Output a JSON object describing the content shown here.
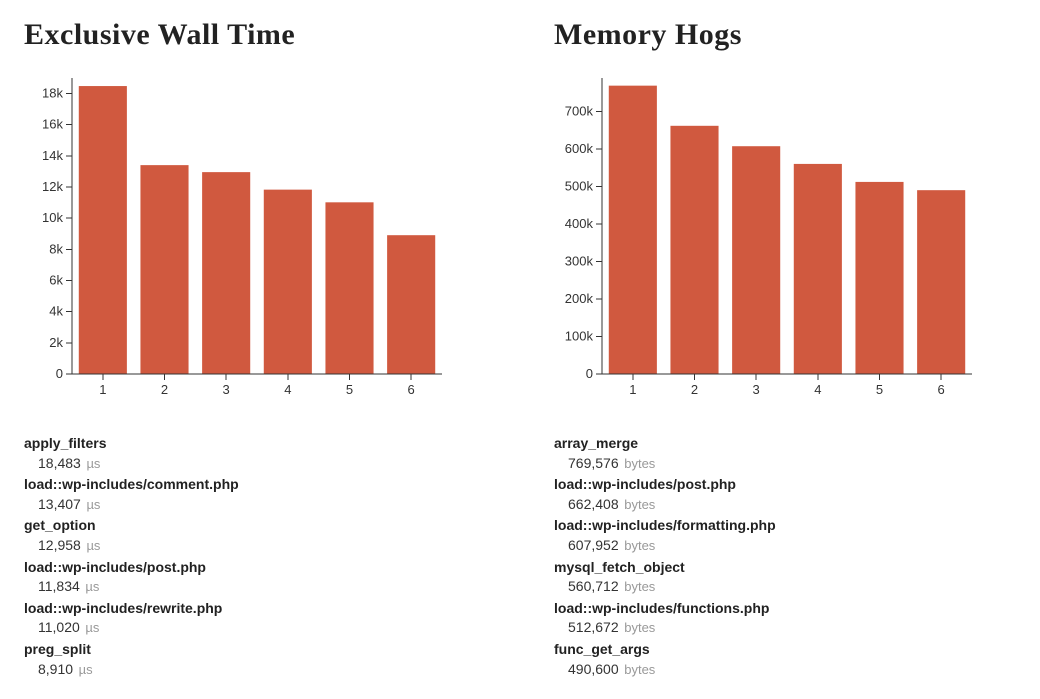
{
  "chart_data": [
    {
      "type": "bar",
      "title": "Exclusive Wall Time",
      "xlabel": "",
      "ylabel": "",
      "categories": [
        "1",
        "2",
        "3",
        "4",
        "5",
        "6"
      ],
      "x_tick_labels": [
        "1",
        "2",
        "3",
        "4",
        "5",
        "6"
      ],
      "values": [
        18483,
        13407,
        12958,
        11834,
        11020,
        8910
      ],
      "y_ticks": [
        0,
        2000,
        4000,
        6000,
        8000,
        10000,
        12000,
        14000,
        16000,
        18000
      ],
      "y_tick_labels": [
        "0",
        "2k",
        "4k",
        "6k",
        "8k",
        "10k",
        "12k",
        "14k",
        "16k",
        "18k"
      ],
      "ylim": [
        0,
        19000
      ],
      "grid": false,
      "unit": "µs",
      "items": [
        {
          "name": "apply_filters",
          "value": "18,483",
          "raw": 18483
        },
        {
          "name": "load::wp-includes/comment.php",
          "value": "13,407",
          "raw": 13407
        },
        {
          "name": "get_option",
          "value": "12,958",
          "raw": 12958
        },
        {
          "name": "load::wp-includes/post.php",
          "value": "11,834",
          "raw": 11834
        },
        {
          "name": "load::wp-includes/rewrite.php",
          "value": "11,020",
          "raw": 11020
        },
        {
          "name": "preg_split",
          "value": "8,910",
          "raw": 8910
        }
      ]
    },
    {
      "type": "bar",
      "title": "Memory Hogs",
      "xlabel": "",
      "ylabel": "",
      "categories": [
        "1",
        "2",
        "3",
        "4",
        "5",
        "6"
      ],
      "x_tick_labels": [
        "1",
        "2",
        "3",
        "4",
        "5",
        "6"
      ],
      "values": [
        769576,
        662408,
        607952,
        560712,
        512672,
        490600
      ],
      "y_ticks": [
        0,
        100000,
        200000,
        300000,
        400000,
        500000,
        600000,
        700000
      ],
      "y_tick_labels": [
        "0",
        "100k",
        "200k",
        "300k",
        "400k",
        "500k",
        "600k",
        "700k"
      ],
      "ylim": [
        0,
        790000
      ],
      "grid": false,
      "unit": "bytes",
      "items": [
        {
          "name": "array_merge",
          "value": "769,576",
          "raw": 769576
        },
        {
          "name": "load::wp-includes/post.php",
          "value": "662,408",
          "raw": 662408
        },
        {
          "name": "load::wp-includes/formatting.php",
          "value": "607,952",
          "raw": 607952
        },
        {
          "name": "mysql_fetch_object",
          "value": "560,712",
          "raw": 560712
        },
        {
          "name": "load::wp-includes/functions.php",
          "value": "512,672",
          "raw": 512672
        },
        {
          "name": "func_get_args",
          "value": "490,600",
          "raw": 490600
        }
      ]
    }
  ]
}
